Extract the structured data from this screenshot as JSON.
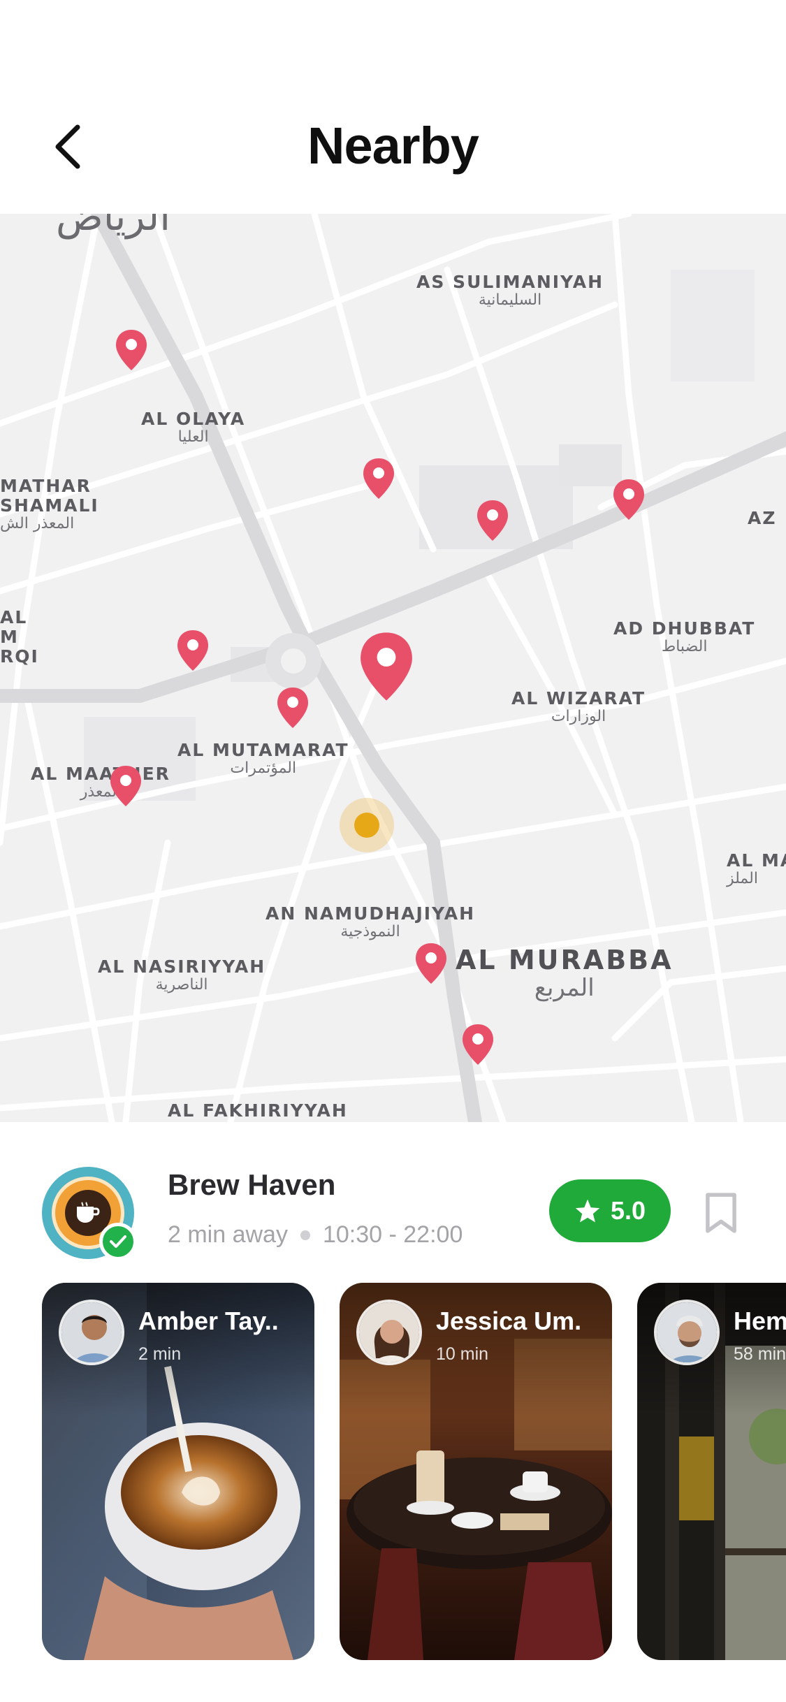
{
  "header": {
    "title": "Nearby",
    "back_icon": "chevron-left-icon"
  },
  "map": {
    "top_arabic": "الرياض",
    "labels": [
      {
        "en": "AS SULIMANIYAH",
        "ar": "السليمانية"
      },
      {
        "en": "AL OLAYA",
        "ar": "العليا"
      },
      {
        "en": "MATHAR",
        "ar": ""
      },
      {
        "en": "SHAMALI",
        "ar": "المعذر الش"
      },
      {
        "en": "AZ",
        "ar": ""
      },
      {
        "en": "AL",
        "ar": ""
      },
      {
        "en": "M",
        "ar": ""
      },
      {
        "en": "RQI",
        "ar": ""
      },
      {
        "en": "AD DHUBBAT",
        "ar": "الضباط"
      },
      {
        "en": "AL WIZARAT",
        "ar": "الوزارات"
      },
      {
        "en": "AL MUTAMARAT",
        "ar": "المؤتمرات"
      },
      {
        "en": "AL MAATHER",
        "ar": "المعذر"
      },
      {
        "en": "AL MA",
        "ar": "الملز"
      },
      {
        "en": "AN NAMUDHAJIYAH",
        "ar": "النموذجية"
      },
      {
        "en": "AL NASIRIYYAH",
        "ar": "الناصرية"
      },
      {
        "en": "AL MURABBA",
        "ar": "المربع"
      },
      {
        "en": "AL FAKHIRIYYAH",
        "ar": ""
      }
    ],
    "pin_color": "#e8506a",
    "user_location_color": "#e6a817"
  },
  "place": {
    "name": "Brew Haven",
    "distance": "2 min away",
    "hours": "10:30 - 22:00",
    "rating": "5.0",
    "rating_color": "#1faa39",
    "logo_icon": "coffee-cup-icon",
    "verified_icon": "check-icon",
    "bookmark_icon": "bookmark-icon"
  },
  "cards": [
    {
      "name": "Amber Tay..",
      "time": "2 min"
    },
    {
      "name": "Jessica Um.",
      "time": "10 min"
    },
    {
      "name": "Hem",
      "time": "58 min"
    }
  ]
}
